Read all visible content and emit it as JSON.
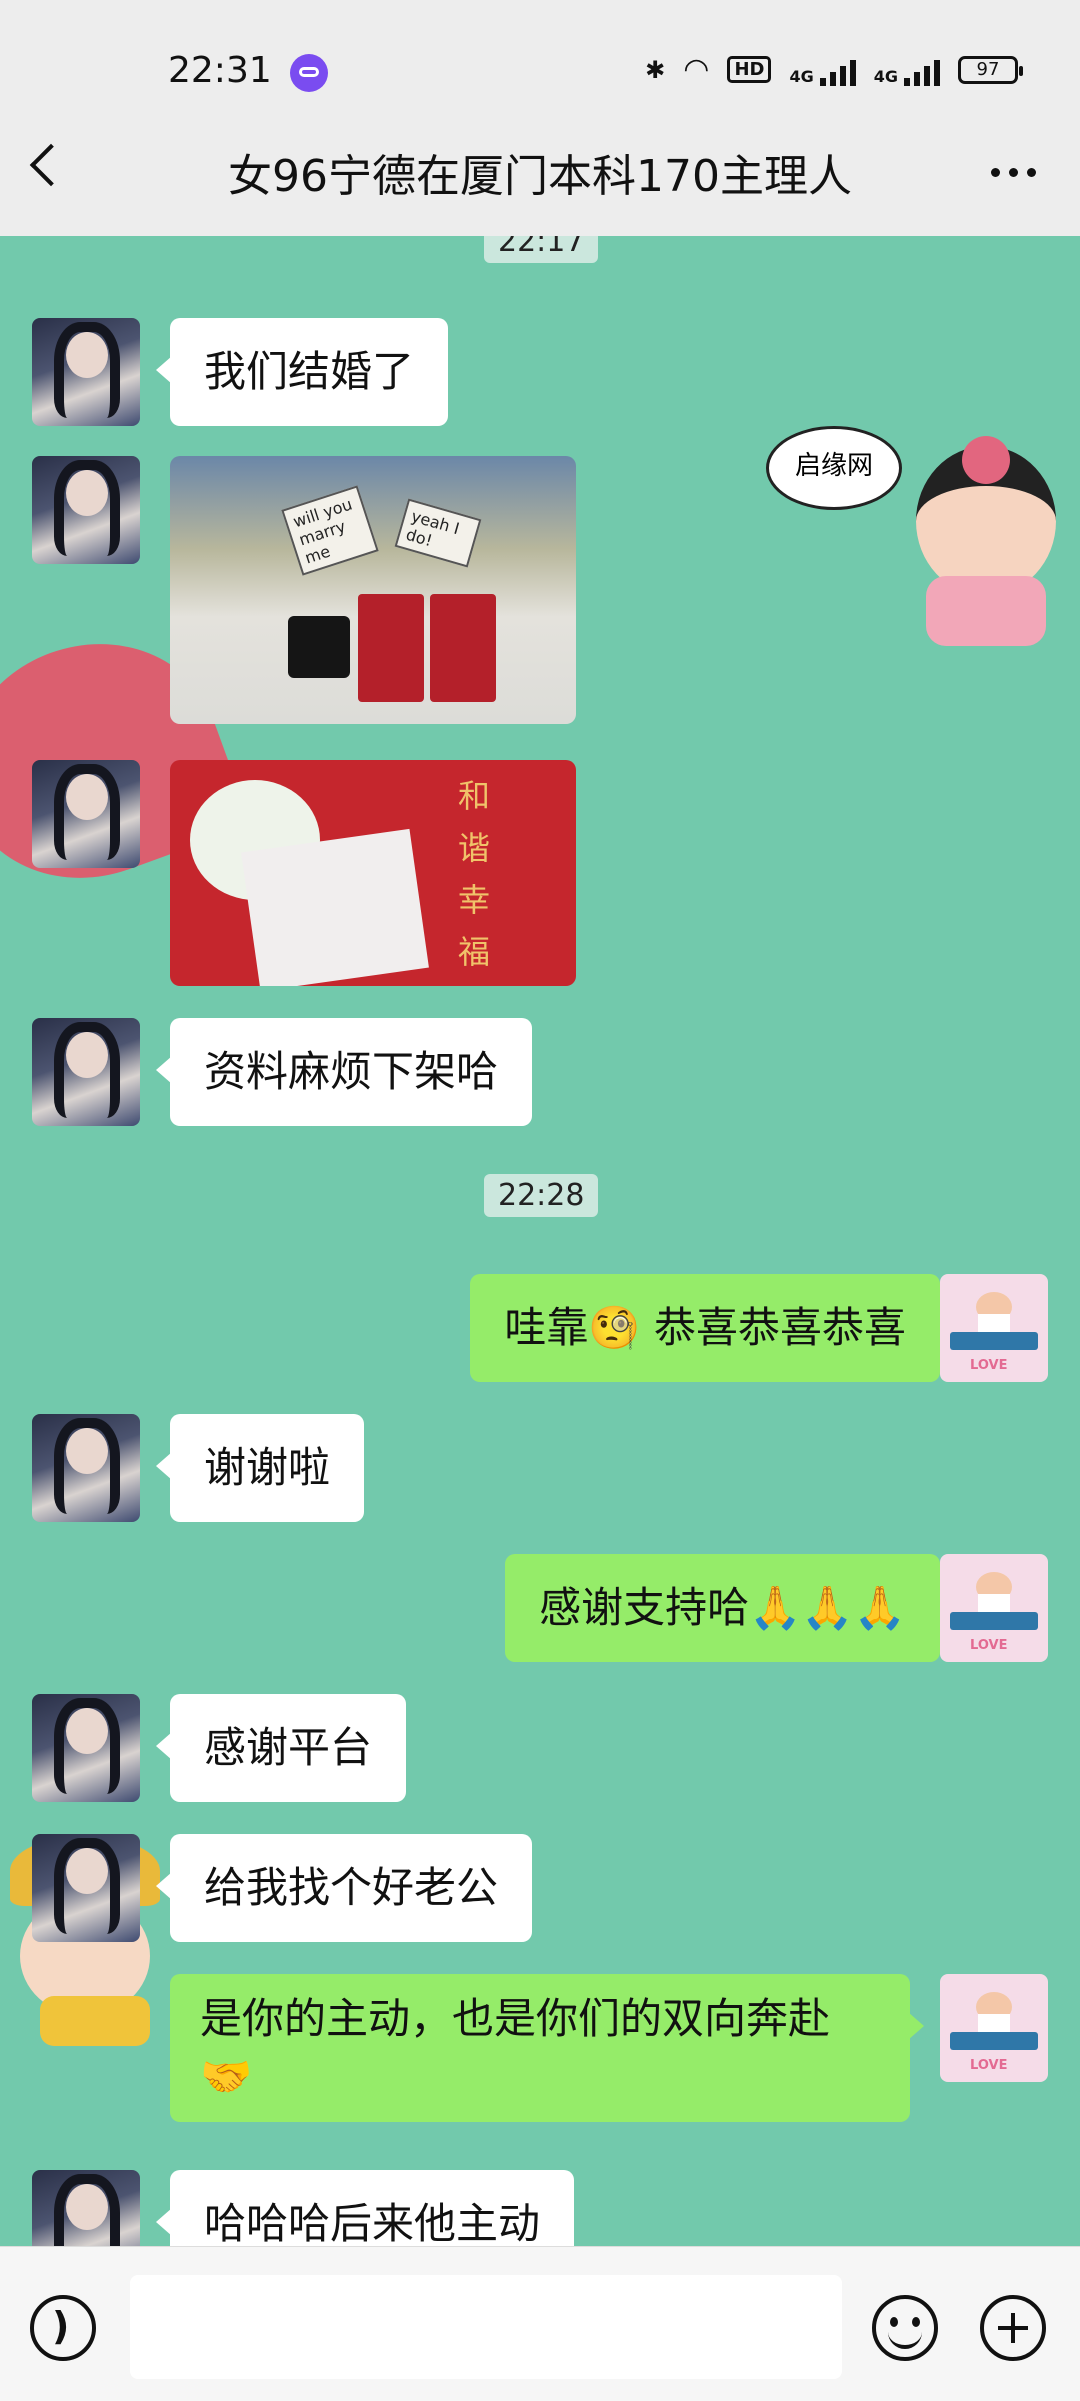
{
  "status_bar": {
    "time": "22:31",
    "hd_label": "HD",
    "signal1_label": "4G",
    "signal2_label": "4G",
    "battery": "97"
  },
  "header": {
    "title": "女96宁德在厦门本科170主理人"
  },
  "chat": {
    "time_top": "22:17",
    "time_mid": "22:28",
    "photo1_card1": "will you marry me",
    "photo1_card2": "yeah I do!",
    "photo2_text": "和谐幸福",
    "sticker_text": "启缘网",
    "messages": [
      {
        "side": "in",
        "text": "我们结婚了"
      },
      {
        "side": "in",
        "text": "资料麻烦下架哈"
      },
      {
        "side": "out",
        "text": "哇靠🧐 恭喜恭喜恭喜"
      },
      {
        "side": "in",
        "text": "谢谢啦"
      },
      {
        "side": "out",
        "text": "感谢支持哈🙏🙏🙏"
      },
      {
        "side": "in",
        "text": "感谢平台"
      },
      {
        "side": "in",
        "text": "给我找个好老公"
      },
      {
        "side": "out",
        "text": "是你的主动，也是你们的双向奔赴🤝"
      },
      {
        "side": "in",
        "text": "哈哈哈后来他主动"
      }
    ],
    "my_avatar_label": "LOVE"
  },
  "colors": {
    "chat_background": "#72c9ac",
    "incoming_bubble": "#ffffff",
    "outgoing_bubble": "#95ec69",
    "time_chip": "#cbe7dd"
  }
}
